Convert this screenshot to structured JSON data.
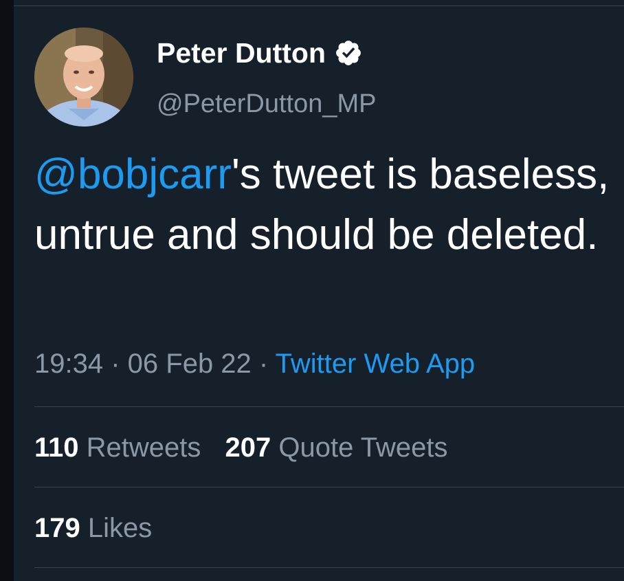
{
  "author": {
    "display_name": "Peter Dutton",
    "handle": "@PeterDutton_MP",
    "verified_icon": "verified-badge-icon"
  },
  "tweet": {
    "mention": "@bobjcarr",
    "text": "'s tweet is baseless, untrue and should be deleted."
  },
  "meta": {
    "time": "19:34",
    "sep1": " · ",
    "date": "06 Feb 22",
    "sep2": " · ",
    "source": "Twitter Web App"
  },
  "stats": {
    "retweets_count": "110",
    "retweets_label": "Retweets",
    "quotes_count": "207",
    "quotes_label": "Quote Tweets",
    "likes_count": "179",
    "likes_label": "Likes"
  },
  "colors": {
    "background": "#15202b",
    "accent": "#1d9bf0",
    "secondary_text": "#8b98a5",
    "divider": "#38444d"
  }
}
